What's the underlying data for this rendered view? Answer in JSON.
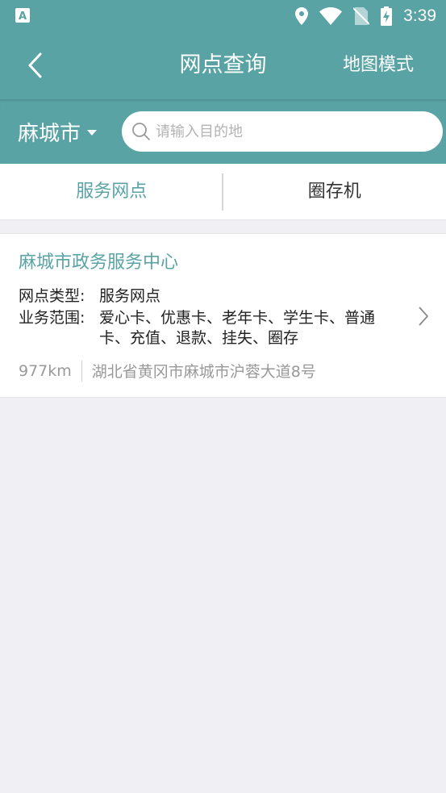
{
  "status_bar": {
    "time": "3:39",
    "icons": [
      "location-icon",
      "wifi-icon",
      "no-sim-icon",
      "battery-charging-icon"
    ],
    "left_icon": "app-notification-icon"
  },
  "header": {
    "title": "网点查询",
    "map_mode_label": "地图模式",
    "back_icon": "back-arrow-icon"
  },
  "search": {
    "city": "麻城市",
    "placeholder": "请输入目的地",
    "value": ""
  },
  "tabs": [
    {
      "label": "服务网点",
      "active": true
    },
    {
      "label": "圈存机",
      "active": false
    }
  ],
  "results": [
    {
      "name": "麻城市政务服务中心",
      "type_label": "网点类型:",
      "type_value": "服务网点",
      "scope_label": "业务范围:",
      "scope_value": "爱心卡、优惠卡、老年卡、学生卡、普通卡、充值、退款、挂失、圈存",
      "distance": "977km",
      "address": "湖北省黄冈市麻城市沪蓉大道8号"
    }
  ],
  "colors": {
    "primary": "#5aa3a5",
    "background": "#efeff4"
  }
}
